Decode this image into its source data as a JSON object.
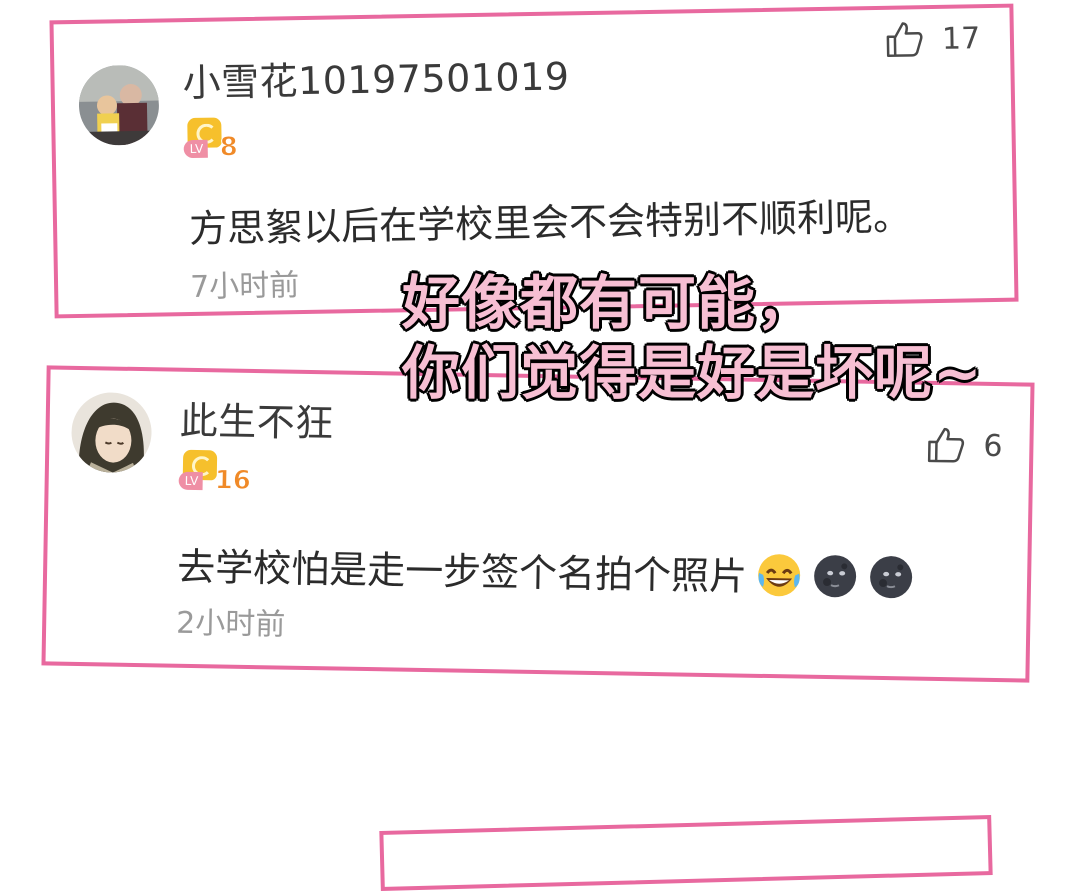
{
  "comments": [
    {
      "username": "小雪花10197501019",
      "level": "8",
      "level_prefix": "LV",
      "text": "方思絮以后在学校里会不会特别不顺利呢。",
      "time": "7小时前",
      "likes": "17"
    },
    {
      "username": "此生不狂",
      "level": "16",
      "level_prefix": "LV",
      "text": "去学校怕是走一步签个名拍个照片",
      "time": "2小时前",
      "likes": "6",
      "emojis": [
        "laughing-tears-emoji",
        "new-moon-face-emoji",
        "new-moon-face-emoji"
      ]
    }
  ],
  "overlay": {
    "line1": "好像都有可能，",
    "line2": "你们觉得是好是坏呢~"
  },
  "colors": {
    "card_border": "#e8699f",
    "overlay_fill": "#f7bfd3",
    "level_badge": "#f6c02c"
  }
}
